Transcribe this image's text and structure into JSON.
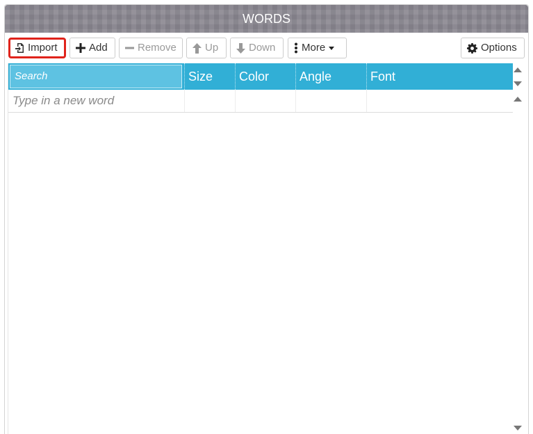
{
  "panel": {
    "title": "WORDS"
  },
  "toolbar": {
    "import_label": "Import",
    "add_label": "Add",
    "remove_label": "Remove",
    "up_label": "Up",
    "down_label": "Down",
    "more_label": "More",
    "options_label": "Options"
  },
  "grid": {
    "search_placeholder": "Search",
    "columns": [
      "Size",
      "Color",
      "Angle",
      "Font"
    ],
    "new_word_placeholder": "Type in a new word"
  },
  "colors": {
    "header_accent": "#31afd6",
    "import_highlight": "#e0231b"
  },
  "icons": [
    "file-import-icon",
    "plus-icon",
    "minus-icon",
    "arrow-up-icon",
    "arrow-down-icon",
    "more-vertical-icon",
    "caret-down-icon",
    "gear-icon",
    "scroll-up-icon",
    "scroll-down-icon"
  ]
}
